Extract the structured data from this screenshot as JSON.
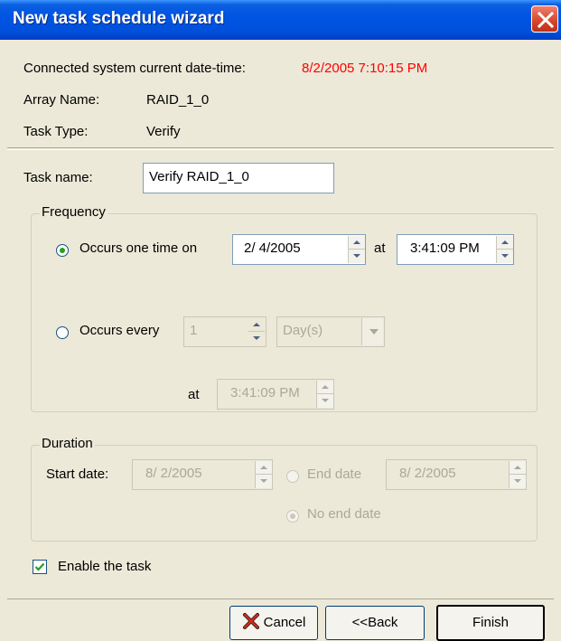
{
  "window": {
    "title": "New task schedule wizard"
  },
  "info": {
    "connected_label": "Connected system current date-time:",
    "connected_value": "8/2/2005 7:10:15 PM",
    "array_label": "Array Name:",
    "array_value": "RAID_1_0",
    "type_label": "Task Type:",
    "type_value": "Verify"
  },
  "task": {
    "name_label": "Task name:",
    "name_value": "Verify RAID_1_0"
  },
  "frequency": {
    "legend": "Frequency",
    "once_label": "Occurs one time on",
    "once_date": "2/  4/2005",
    "at_label": "at",
    "once_time": "3:41:09 PM",
    "every_label": "Occurs every",
    "every_count": "1",
    "every_unit": "Day(s)",
    "every_at_label": "at",
    "every_time": "3:41:09 PM"
  },
  "duration": {
    "legend": "Duration",
    "start_label": "Start date:",
    "start_value": "8/  2/2005",
    "end_label": "End date",
    "end_value": "8/  2/2005",
    "no_end_label": "No end date"
  },
  "enable": {
    "label": "Enable the task"
  },
  "buttons": {
    "cancel": "Cancel",
    "back": "<<Back",
    "finish": "Finish"
  },
  "colors": {
    "title_bar": "#0054e3",
    "date_value": "#ff0000",
    "window_bg": "#ece9d8"
  }
}
